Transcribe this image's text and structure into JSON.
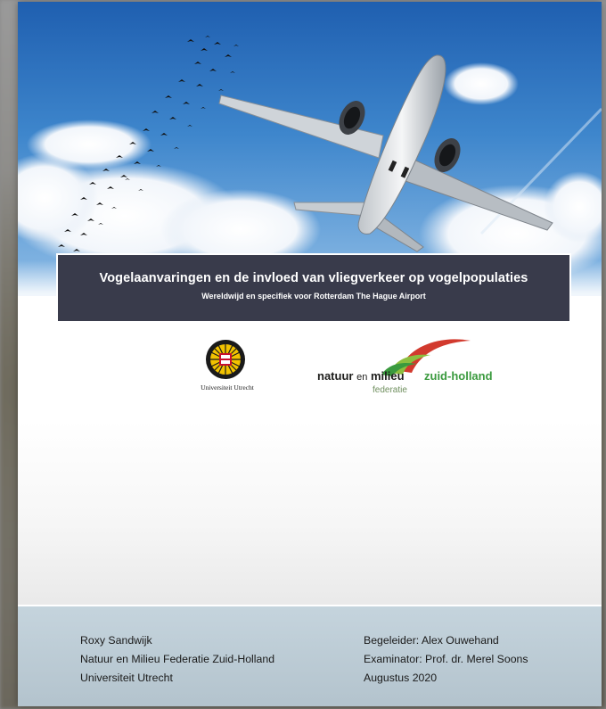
{
  "report": {
    "title": "Vogelaanvaringen en de invloed van vliegverkeer op vogelpopulaties",
    "subtitle": "Wereldwijd en specifiek voor Rotterdam The Hague Airport"
  },
  "logos": {
    "uu_name": "Universiteit Utrecht",
    "nmf_part1": "natuur",
    "nmf_part2": "en",
    "nmf_part3": "milieu",
    "nmf_part4": "zuid-holland",
    "nmf_sub": "federatie"
  },
  "footer": {
    "author": "Roxy Sandwijk",
    "organisation": "Natuur en Milieu Federatie Zuid-Holland",
    "university": "Universiteit Utrecht",
    "supervisor": "Begeleider: Alex Ouwehand",
    "examiner": "Examinator: Prof. dr. Merel Soons",
    "date": "Augustus 2020"
  },
  "colors": {
    "banner": "#393b4b",
    "footer": "#c5d4dd",
    "nmf_green": "#3a9a3e",
    "nmf_red": "#d23a2e",
    "sky_top": "#1f5fb0"
  }
}
